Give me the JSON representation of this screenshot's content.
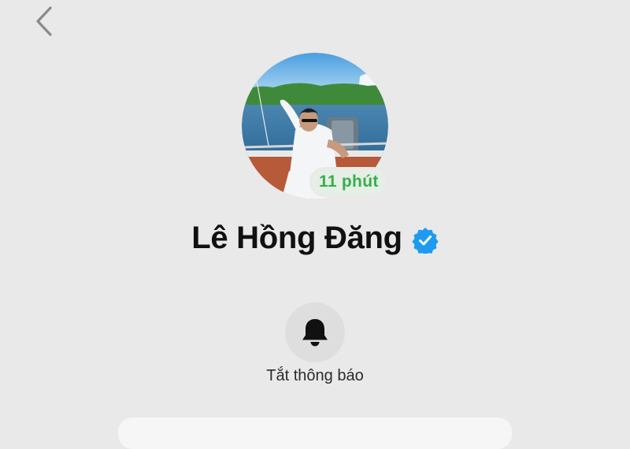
{
  "header": {
    "back_icon": "chevron-left-icon"
  },
  "profile": {
    "name": "Lê Hồng Đăng",
    "verified_icon": "verified-badge-icon",
    "active_status": "11 phút",
    "avatar_description_icon": "profile-photo"
  },
  "actions": {
    "mute": {
      "icon": "bell-icon",
      "label": "Tắt thông báo"
    }
  },
  "colors": {
    "background": "#e9e9e9",
    "status_green": "#34b04a",
    "verified_blue": "#1d9bf0",
    "text_primary": "#111111"
  }
}
